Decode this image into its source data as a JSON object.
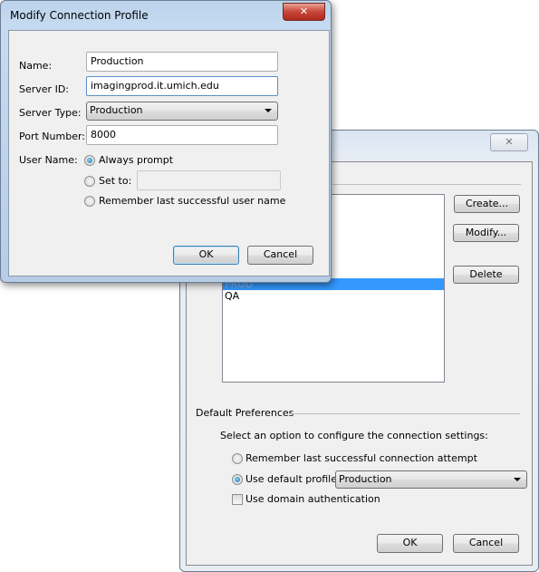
{
  "modify_dialog": {
    "title": "Modify Connection Profile",
    "name_label": "Name:",
    "name_value": "Production",
    "server_id_label": "Server ID:",
    "server_id_value": "imagingprod.it.umich.edu",
    "server_type_label": "Server Type:",
    "server_type_value": "Production",
    "port_label": "Port Number:",
    "port_value": "8000",
    "user_name_label": "User Name:",
    "opt_always": "Always prompt",
    "opt_set_to": "Set to:",
    "set_to_value": "",
    "opt_remember": "Remember last successful user name",
    "selected_option": "Always prompt",
    "ok": "OK",
    "cancel": "Cancel"
  },
  "profiles_dialog": {
    "profiles": [
      "PROD",
      "QA"
    ],
    "selected_profile": "PROD",
    "create": "Create...",
    "modify": "Modify...",
    "delete": "Delete",
    "default_prefs_label": "Default Preferences",
    "instruction": "Select an option to configure the connection settings:",
    "opt_remember": "Remember last successful connection attempt",
    "opt_default": "Use default profile:",
    "default_profile_value": "Production",
    "domain_auth": "Use domain authentication",
    "domain_auth_checked": false,
    "ok": "OK",
    "cancel": "Cancel"
  },
  "colors": {
    "selection": "#3399ff",
    "frame": "#c3d8ee",
    "close_red": "#c7463a"
  }
}
